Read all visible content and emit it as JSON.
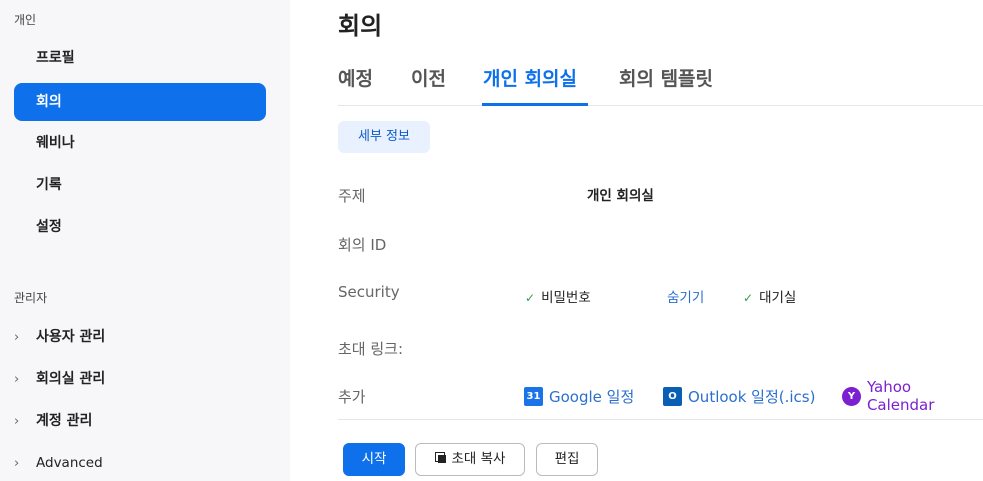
{
  "sidebar": {
    "personal_label": "개인",
    "personal_items": [
      {
        "label": "프로필"
      },
      {
        "label": "회의"
      },
      {
        "label": "웨비나"
      },
      {
        "label": "기록"
      },
      {
        "label": "설정"
      }
    ],
    "admin_label": "관리자",
    "admin_items": [
      {
        "label": "사용자 관리"
      },
      {
        "label": "회의실 관리"
      },
      {
        "label": "계정 관리"
      },
      {
        "label": "Advanced"
      }
    ],
    "chevron": "›"
  },
  "main": {
    "title": "회의",
    "tabs": [
      {
        "label": "예정"
      },
      {
        "label": "이전"
      },
      {
        "label": "개인 회의실"
      },
      {
        "label": "회의 템플릿"
      }
    ],
    "detail_button": "세부 정보",
    "rows": {
      "topic_label": "주제",
      "topic_value": "개인 회의실",
      "meeting_id_label": "회의 ID",
      "security_label": "Security",
      "security_items": {
        "passcode": "비밀번호",
        "hide": "숨기기",
        "waiting_room": "대기실"
      },
      "invite_label": "초대 링크:",
      "add_label": "추가"
    },
    "calendars": {
      "google": "Google 일정",
      "google_icon_text": "31",
      "outlook": "Outlook 일정(.ics)",
      "outlook_icon_text": "O",
      "yahoo": "Yahoo Calendar",
      "yahoo_icon_text": "Y"
    },
    "actions": {
      "start": "시작",
      "copy_invite": "초대 복사",
      "edit": "편집"
    },
    "check_mark": "✓"
  },
  "colors": {
    "accent": "#0e71eb",
    "sidebar_bg": "#f7f7fa",
    "check": "#2e9e4a",
    "yahoo": "#7b1fd1"
  }
}
